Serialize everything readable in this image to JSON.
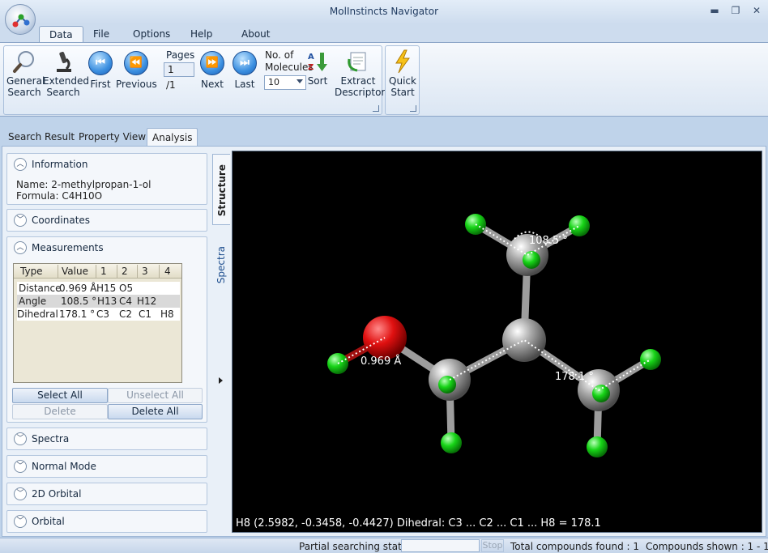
{
  "window": {
    "title": "MolInstincts Navigator",
    "controls": [
      "minimize-icon",
      "restore-icon",
      "close-icon"
    ]
  },
  "ribbon_tabs": [
    "Data",
    "File",
    "Options",
    "Help",
    "About"
  ],
  "ribbon": {
    "general_search": [
      "General",
      "Search"
    ],
    "extended_search": [
      "Extended",
      "Search"
    ],
    "first": "First",
    "previous": "Previous",
    "pages_label": "Pages",
    "pages_value": "1",
    "pages_total": "/1",
    "next": "Next",
    "last": "Last",
    "molecules_label": [
      "No. of",
      "Molecules"
    ],
    "molecules_value": "10",
    "sort": "Sort",
    "extract_descriptor": [
      "Extract",
      "Descriptor"
    ],
    "quick_start": [
      "Quick",
      "Start"
    ]
  },
  "content_tabs": [
    "Search Result",
    "Property View",
    "Analysis"
  ],
  "panels": {
    "information": {
      "title": "Information",
      "name": "Name: 2-methylpropan-1-ol",
      "formula": "Formula: C4H10O"
    },
    "coordinates": "Coordinates",
    "measurements": {
      "title": "Measurements",
      "columns": [
        "Type",
        "Value",
        "1",
        "2",
        "3",
        "4"
      ],
      "rows": [
        [
          "Distance",
          "0.969 Å",
          "H15",
          "O5",
          "",
          ""
        ],
        [
          "Angle",
          "108.5 °",
          "H13",
          "C4",
          "H12",
          ""
        ],
        [
          "Dihedral",
          "178.1 °",
          "C3",
          "C2",
          "C1",
          "H8"
        ]
      ],
      "buttons": {
        "select_all": "Select All",
        "unselect_all": "Unselect All",
        "delete": "Delete",
        "delete_all": "Delete All"
      }
    },
    "spectra": "Spectra",
    "normal_mode": "Normal Mode",
    "orbital_2d": "2D Orbital",
    "orbital": "Orbital"
  },
  "side_tabs": [
    "Structure",
    "Spectra"
  ],
  "viewer": {
    "labels": {
      "distance": "0.969 Å",
      "angle": "108.5 °",
      "dihedral": "178.1 °"
    },
    "status": "H8 (2.5982, -0.3458, -0.4427)   Dihedral: C3 ... C2 ... C1 ... H8 = 178.1",
    "colors": {
      "oxygen": "#e01010",
      "carbon": "#9a9a9a",
      "hydrogen": "#17d417",
      "bond": "#9d9d9d"
    }
  },
  "statusbar": {
    "partial_label": "Partial searching status :",
    "stop": "Stop",
    "total": "Total compounds found : 1",
    "shown": "Compounds shown : 1 - 1"
  }
}
